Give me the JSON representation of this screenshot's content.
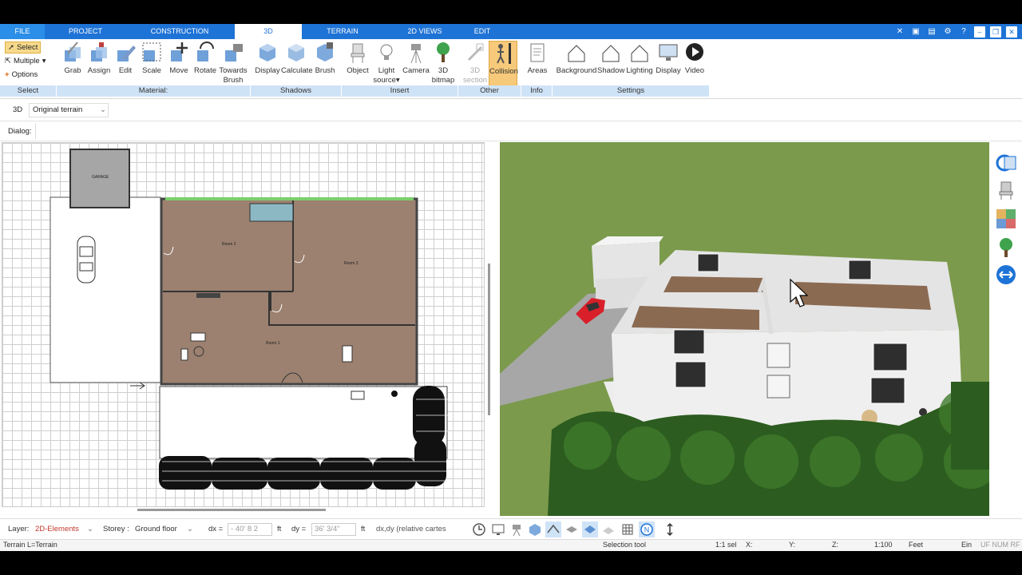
{
  "menu": {
    "tabs": [
      "FILE",
      "PROJECT",
      "CONSTRUCTION",
      "3D",
      "TERRAIN",
      "2D VIEWS",
      "EDIT"
    ],
    "active": "3D"
  },
  "ribbon": {
    "select": {
      "select": "Select",
      "multiple": "Multiple",
      "options": "Options"
    },
    "material": {
      "grab": "Grab",
      "assign": "Assign",
      "edit": "Edit",
      "scale": "Scale",
      "move": "Move",
      "rotate": "Rotate",
      "towards_brush_1": "Towards",
      "towards_brush_2": "Brush"
    },
    "shadows": {
      "display": "Display",
      "calculate": "Calculate",
      "brush": "Brush"
    },
    "insert": {
      "object": "Object",
      "light_source_1": "Light",
      "light_source_2": "source",
      "camera": "Camera",
      "bitmap_1": "3D",
      "bitmap_2": "bitmap"
    },
    "other": {
      "section_1": "3D",
      "section_2": "section",
      "collision": "Collision"
    },
    "info": {
      "areas": "Areas"
    },
    "settings": {
      "background": "Background",
      "shadow": "Shadow",
      "lighting": "Lighting",
      "display": "Display",
      "video": "Video"
    },
    "groups": {
      "select": "Select",
      "material": "Material:",
      "shadows": "Shadows",
      "insert": "Insert",
      "other": "Other",
      "info": "Info",
      "settings": "Settings"
    }
  },
  "subbar": {
    "mode": "3D",
    "terrain_select": "Original terrain"
  },
  "dialog": {
    "label": "Dialog:"
  },
  "plan": {
    "garage_label": "GARAGE",
    "room2": "Room 2",
    "room3": "Room 3",
    "room1": "Room 1"
  },
  "bottombar": {
    "layer_label": "Layer:",
    "layer_value": "2D-Elements",
    "storey_label": "Storey :",
    "storey_value": "Ground floor",
    "dx_label": "dx =",
    "dx_value": "- 40' 8 2",
    "dx_unit": "ft",
    "dy_label": "dy =",
    "dy_value": "36' 3/4\"",
    "dy_unit": "ft",
    "mode_value": "dx,dy (relative cartes"
  },
  "statusbar": {
    "terrain": "Terrain L=Terrain",
    "tool": "Selection tool",
    "sel": "1:1 sel",
    "x": "X:",
    "y": "Y:",
    "z": "Z:",
    "scale": "1:100",
    "units": "Feet",
    "ein": "Ein",
    "flags": "UF NUM RF"
  },
  "colors": {
    "accent": "#1e73d6",
    "group_bg": "#cfe3f7",
    "pressed": "#f7c97a",
    "floor": "#a08470",
    "grass": "#7a9a4a"
  }
}
